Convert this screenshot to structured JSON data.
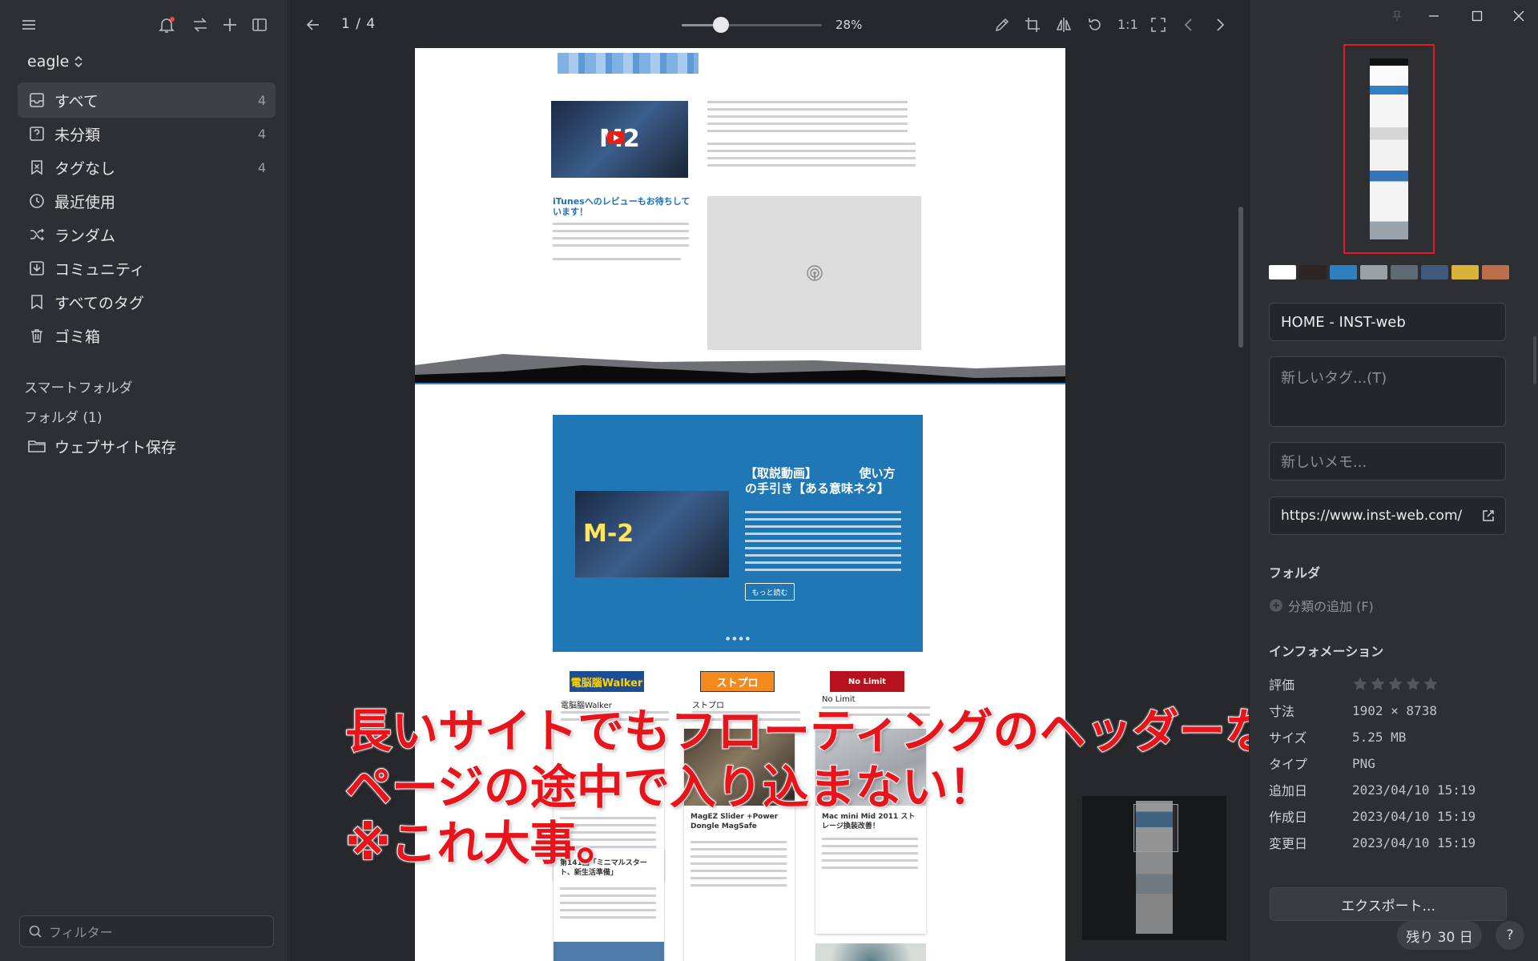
{
  "sidebar": {
    "library_name": "eagle",
    "nav_items": [
      {
        "label": "すべて",
        "count": "4"
      },
      {
        "label": "未分類",
        "count": "4"
      },
      {
        "label": "タグなし",
        "count": "4"
      },
      {
        "label": "最近使用",
        "count": ""
      },
      {
        "label": "ランダム",
        "count": ""
      },
      {
        "label": "コミュニティ",
        "count": ""
      },
      {
        "label": "すべてのタグ",
        "count": ""
      },
      {
        "label": "ゴミ箱",
        "count": ""
      }
    ],
    "smart_folders_label": "スマートフォルダ",
    "folders_label": "フォルダ (1)",
    "folder_items": [
      {
        "label": "ウェブサイト保存"
      }
    ],
    "filter_placeholder": "フィルター"
  },
  "viewer": {
    "page_indicator": "1 / 4",
    "zoom_label": "28%",
    "zoom_fraction": 0.28,
    "actual_size_label": "1:1",
    "preview": {
      "itunes_heading": "iTunesへのレビューもお待ちしています！",
      "banner_title": "【取説動画】　　　　使い方の手引き【ある意味ネタ】",
      "banner_button": "もっと読む",
      "card_logos": [
        "電脳腦Walker",
        "ストプロ",
        "No Limit"
      ],
      "card_labels": [
        "電脳腦Walker",
        "ストプロ",
        "No Limit"
      ],
      "card_titles": [
        "MagEZ Slider +Power Dongle MagSafe",
        "Mac mini Mid 2011 ストレージ換装改善！",
        "第141回「ミニマルスタート、新生活準備」"
      ]
    },
    "overlay_lines": [
      "長いサイトでもフローティングのヘッダーなどが",
      "ページの途中で入り込まない！",
      "※これ大事。"
    ]
  },
  "inspector": {
    "palette": [
      "#ffffff",
      "#2d2424",
      "#2f7fc0",
      "#9aa1a4",
      "#5e6b73",
      "#3f5a7a",
      "#d9b23a",
      "#b86f4a"
    ],
    "title_value": "HOME - INST-web",
    "tags_placeholder": "新しいタグ...(T)",
    "memo_placeholder": "新しいメモ...",
    "url_value": "https://www.inst-web.com/",
    "folder_heading": "フォルダ",
    "add_folder_label": "分類の追加 (F)",
    "info_heading": "インフォメーション",
    "info": [
      {
        "key": "評価",
        "value": ""
      },
      {
        "key": "寸法",
        "value": "1902 × 8738"
      },
      {
        "key": "サイズ",
        "value": "5.25 MB"
      },
      {
        "key": "タイプ",
        "value": "PNG"
      },
      {
        "key": "追加日",
        "value": "2023/04/10 15:19"
      },
      {
        "key": "作成日",
        "value": "2023/04/10 15:19"
      },
      {
        "key": "変更日",
        "value": "2023/04/10 15:19"
      }
    ],
    "rating": 0,
    "export_label": "エクスポート...",
    "trial_label": "残り 30 日",
    "help_label": "?"
  },
  "theme": {
    "accent_red": "#e11b22",
    "notification_dot": "#e5484d"
  }
}
